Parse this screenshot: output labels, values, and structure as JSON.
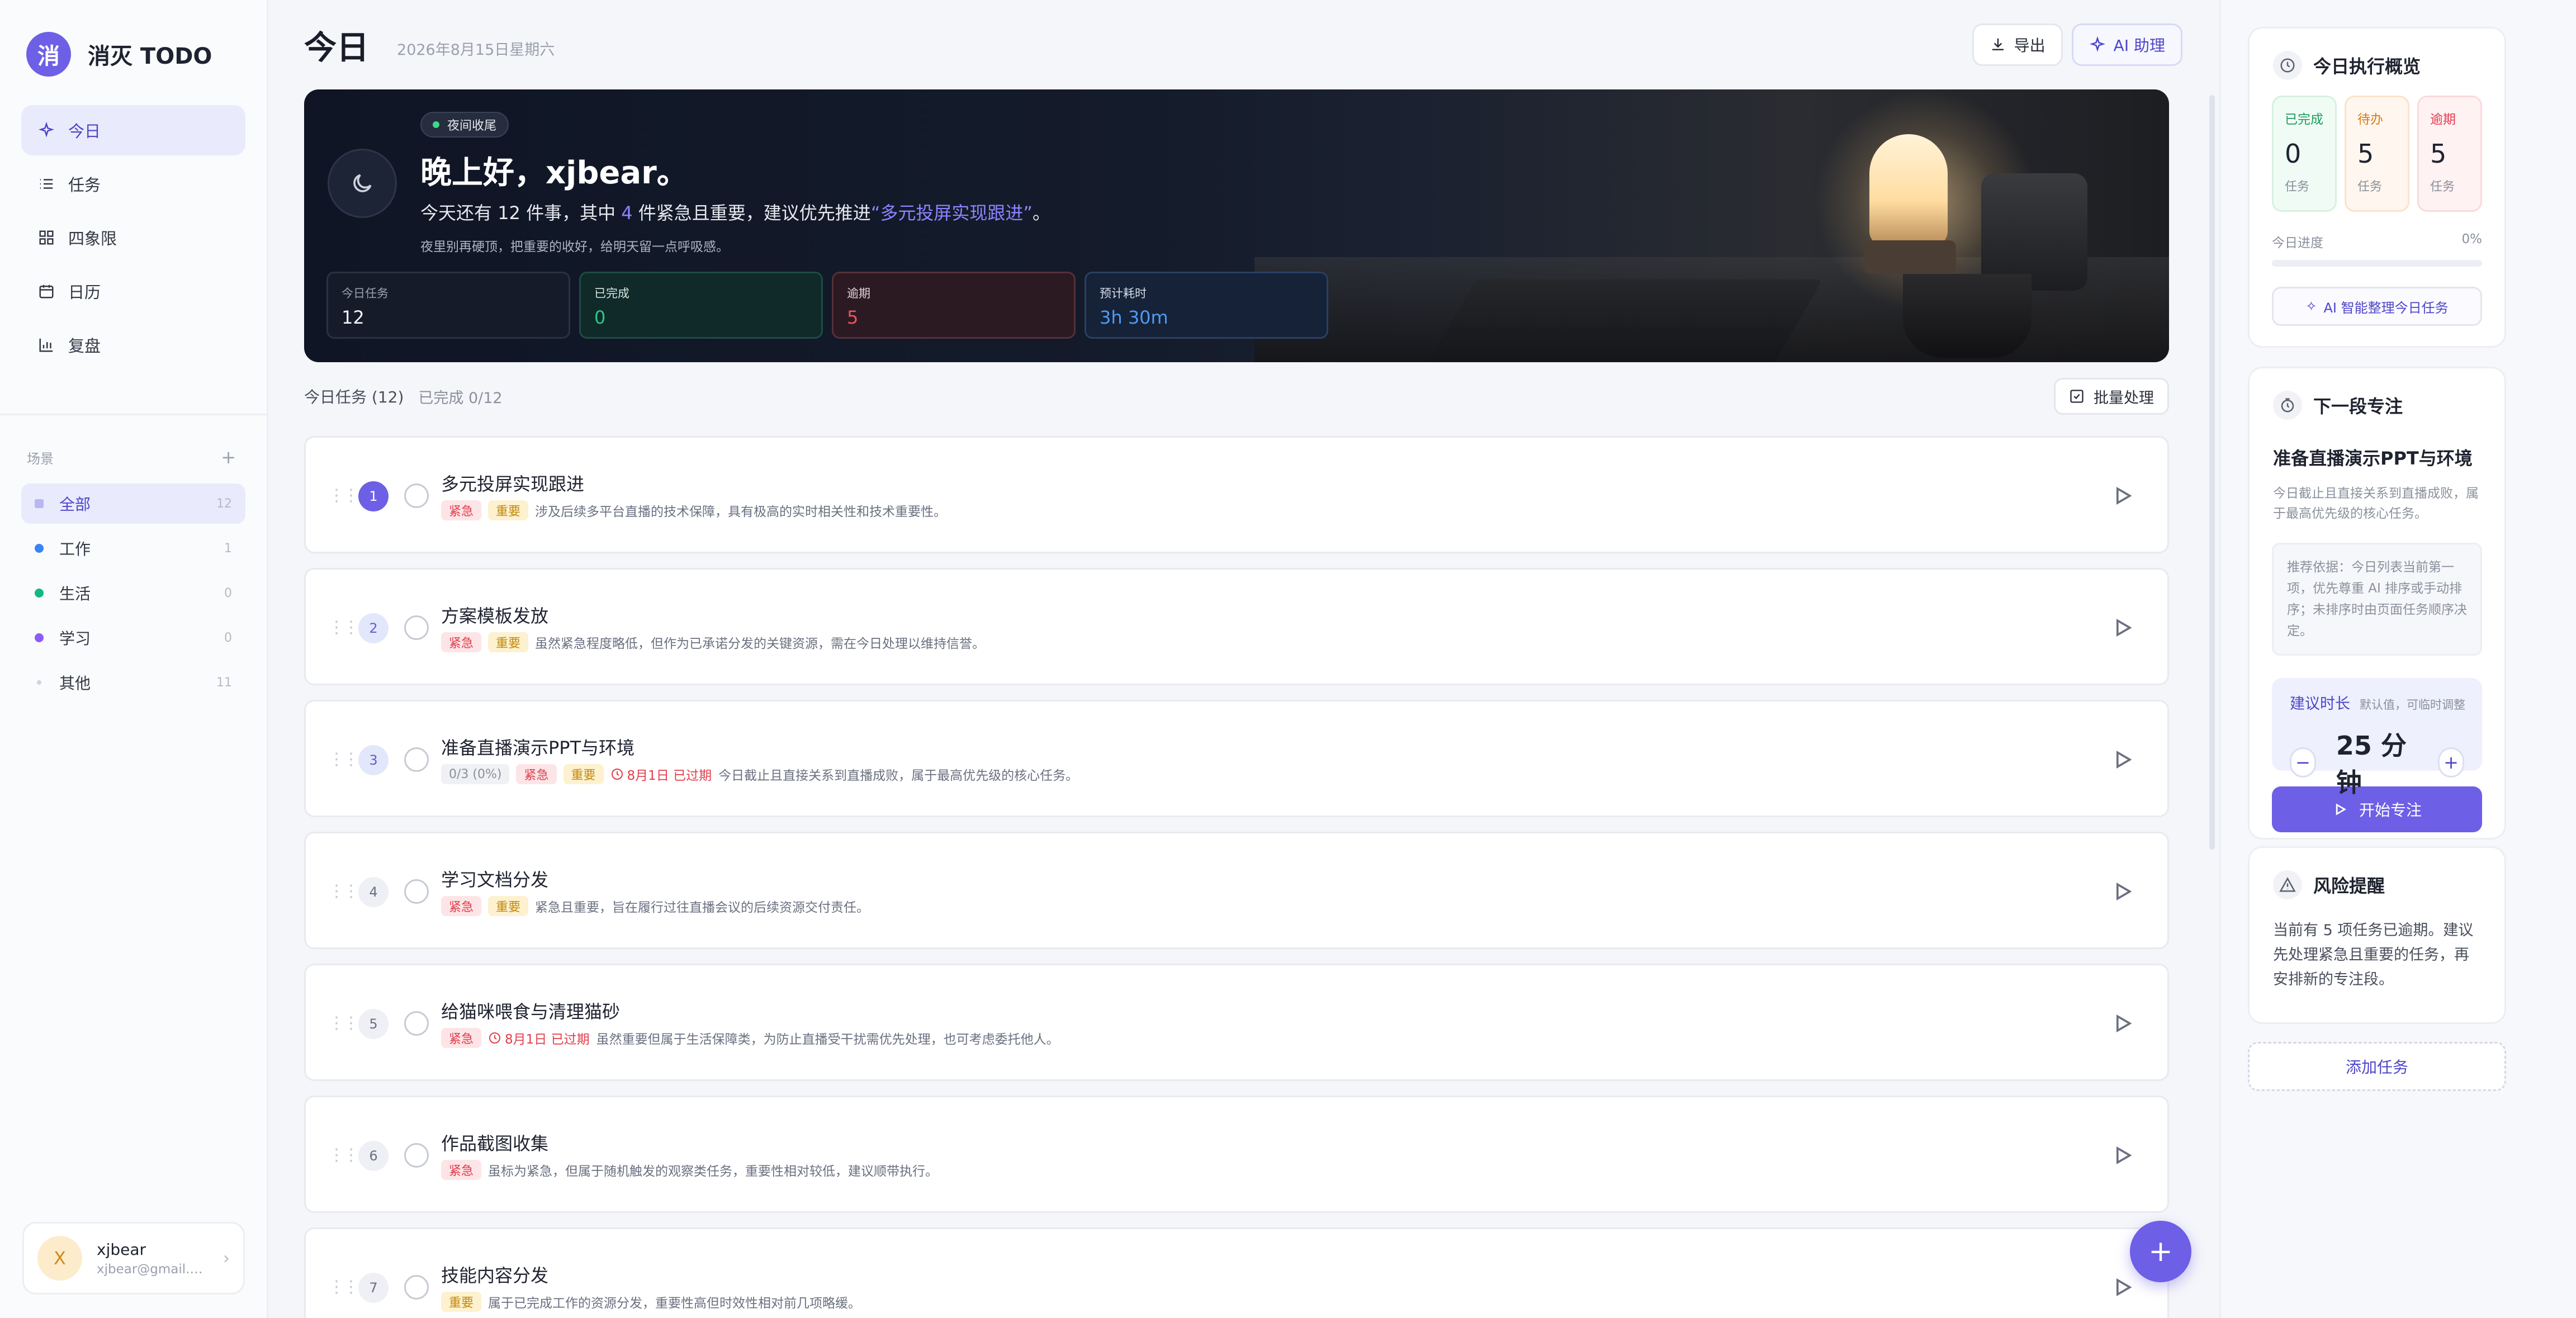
{
  "app": {
    "logo_char": "消",
    "name": "消灭 TODO"
  },
  "nav": [
    {
      "label": "今日",
      "icon": "sparkle-icon",
      "active": true
    },
    {
      "label": "任务",
      "icon": "list-icon"
    },
    {
      "label": "四象限",
      "icon": "grid-icon"
    },
    {
      "label": "日历",
      "icon": "calendar-icon"
    },
    {
      "label": "复盘",
      "icon": "bar-chart-icon"
    }
  ],
  "scenes": {
    "title": "场景",
    "add": "+",
    "items": [
      {
        "label": "全部",
        "count": "12",
        "color": "#b9b6f2"
      },
      {
        "label": "工作",
        "count": "1",
        "color": "#3b82f6"
      },
      {
        "label": "生活",
        "count": "0",
        "color": "#10b981"
      },
      {
        "label": "学习",
        "count": "0",
        "color": "#8b5cf6"
      },
      {
        "label": "其他",
        "count": "11",
        "color": "#cbd5e1"
      }
    ]
  },
  "user": {
    "avatar": "X",
    "name": "xjbear",
    "email": "xjbear@gmail.com"
  },
  "header": {
    "title": "今日",
    "date": "2026年8月15日星期六",
    "export_label": "导出",
    "ai_label": "AI 助理"
  },
  "hero": {
    "tag": "夜间收尾",
    "greeting": "晚上好，xjbear。",
    "line_pre": "今天还有 ",
    "line_total": "12",
    "line_mid": " 件事，其中 ",
    "line_urgent": "4",
    "line_mid2": " 件紧急且重要，建议优先推进",
    "line_task": "“多元投屏实现跟进”",
    "line_end": "。",
    "sub": "夜里别再硬顶，把重要的收好，给明天留一点呼吸感。",
    "stats": [
      {
        "label": "今日任务",
        "value": "12"
      },
      {
        "label": "已完成",
        "value": "0"
      },
      {
        "label": "逾期",
        "value": "5"
      },
      {
        "label": "预计耗时",
        "value": "3h 30m"
      }
    ]
  },
  "list": {
    "title": "今日任务 (12)",
    "done": "已完成 0/12",
    "batch_label": "批量处理"
  },
  "tasks": [
    {
      "num": "1",
      "title": "多元投屏实现跟进",
      "urgent": "紧急",
      "important": "重要",
      "desc": "涉及后续多平台直播的技术保障，具有极高的实时相关性和技术重要性。"
    },
    {
      "num": "2",
      "title": "方案模板发放",
      "urgent": "紧急",
      "important": "重要",
      "desc": "虽然紧急程度略低，但作为已承诺分发的关键资源，需在今日处理以维持信誉。"
    },
    {
      "num": "3",
      "title": "准备直播演示PPT与环境",
      "subtasks": "0/3",
      "subtasks_pct": "(0%)",
      "urgent": "紧急",
      "important": "重要",
      "late": "8月1日 已过期",
      "desc": "今日截止且直接关系到直播成败，属于最高优先级的核心任务。"
    },
    {
      "num": "4",
      "title": "学习文档分发",
      "urgent": "紧急",
      "important": "重要",
      "desc": "紧急且重要，旨在履行过往直播会议的后续资源交付责任。"
    },
    {
      "num": "5",
      "title": "给猫咪喂食与清理猫砂",
      "urgent": "紧急",
      "late": "8月1日 已过期",
      "desc": "虽然重要但属于生活保障类，为防止直播受干扰需优先处理，也可考虑委托他人。"
    },
    {
      "num": "6",
      "title": "作品截图收集",
      "urgent": "紧急",
      "desc": "虽标为紧急，但属于随机触发的观察类任务，重要性相对较低，建议顺带执行。"
    },
    {
      "num": "7",
      "title": "技能内容分发",
      "important": "重要",
      "desc": "属于已完成工作的资源分发，重要性高但时效性相对前几项略缓。"
    }
  ],
  "fab": "+",
  "overview": {
    "title": "今日执行概览",
    "boxes": [
      {
        "label": "已完成",
        "value": "0",
        "unit": "任务"
      },
      {
        "label": "待办",
        "value": "5",
        "unit": "任务"
      },
      {
        "label": "逾期",
        "value": "5",
        "unit": "任务"
      }
    ],
    "progress_label": "今日进度",
    "progress_value": "0%",
    "progress_fraction": 0,
    "ai_label": "AI 智能整理今日任务"
  },
  "focus": {
    "title": "下一段专注",
    "task": "准备直播演示PPT与环境",
    "desc": "今日截止且直接关系到直播成败，属于最高优先级的核心任务。",
    "basis": "推荐依据：今日列表当前第一项，优先尊重 AI 排序或手动排序；未排序时由页面任务顺序决定。",
    "duration_label": "建议时长",
    "duration_hint": "默认值，可临时调整",
    "minus": "−",
    "plus": "+",
    "duration_value": "25 分钟",
    "start_label": "开始专注"
  },
  "risk": {
    "title": "风险提醒",
    "text": "当前有 5 项任务已逾期。建议先处理紧急且重要的任务，再安排新的专注段。"
  },
  "add_task": "添加任务",
  "colors": {
    "accent": "#6d5fe6",
    "urgent": "#e03e4d",
    "important": "#c48a0f",
    "done": "#2bc68a",
    "eta": "#4e9bf5"
  }
}
